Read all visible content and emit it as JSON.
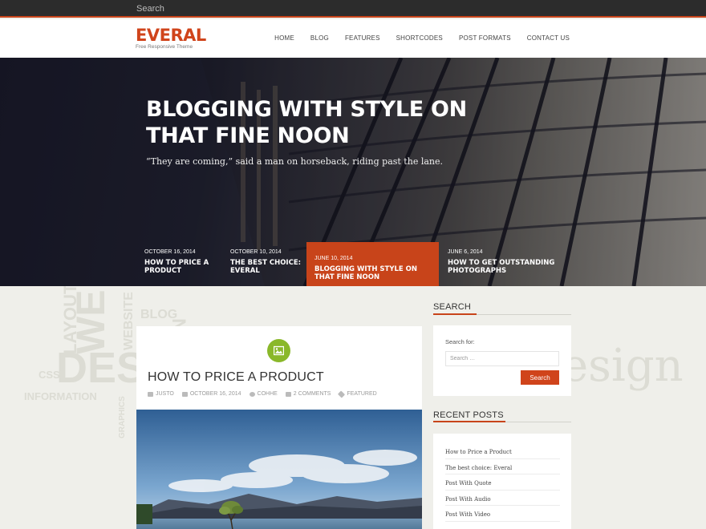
{
  "topbar": {
    "search_placeholder": "Search"
  },
  "header": {
    "logo": "EVERAL",
    "tagline": "Free Responsive Theme",
    "nav": [
      "HOME",
      "BLOG",
      "FEATURES",
      "SHORTCODES",
      "POST FORMATS",
      "CONTACT US"
    ]
  },
  "hero": {
    "title": "BLOGGING WITH STYLE ON THAT FINE NOON",
    "subtitle": "“They are coming,” said a man on horseback, riding past the lane.",
    "slides": [
      {
        "date": "OCTOBER 16, 2014",
        "title": "HOW TO PRICE A PRODUCT",
        "active": false
      },
      {
        "date": "OCTOBER 10, 2014",
        "title": "THE BEST CHOICE: EVERAL",
        "active": false
      },
      {
        "date": "JUNE 10, 2014",
        "title": "BLOGGING WITH STYLE ON THAT FINE NOON",
        "active": true
      },
      {
        "date": "JUNE 6, 2014",
        "title": "HOW TO GET OUTSTANDING PHOTOGRAPHS",
        "active": false
      }
    ]
  },
  "post": {
    "title": "HOW TO PRICE A PRODUCT",
    "meta": {
      "author": "JUSTO",
      "date": "OCTOBER 16, 2014",
      "user": "COHHE",
      "comments": "2 COMMENTS",
      "category": "FEATURED"
    },
    "format_icon": "image-icon"
  },
  "sidebar": {
    "search": {
      "title": "SEARCH",
      "label": "Search for:",
      "placeholder": "Search …",
      "button": "Search"
    },
    "recent": {
      "title": "RECENT POSTS",
      "items": [
        "How to Price a Product",
        "The best choice: Everal",
        "Post With Quote",
        "Post With Audio",
        "Post With Video"
      ]
    }
  },
  "background_words": [
    "LAYOUT",
    "WE",
    "BLOG",
    "NT",
    "WEBSITE",
    "DESIG",
    "INFORMATION",
    "CSS",
    "GRAPHICS",
    "esign"
  ],
  "colors": {
    "accent": "#c8441a",
    "post_format": "#8ab82a",
    "topbar": "#2c2c2c"
  }
}
